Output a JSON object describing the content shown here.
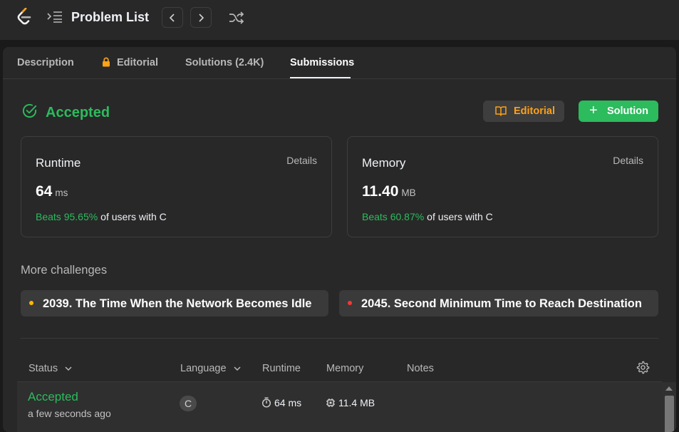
{
  "topbar": {
    "logo": "leetcode-logo",
    "problem_list_icon": "list-indent-icon",
    "title": "Problem List",
    "prev_icon": "chevron-left-icon",
    "next_icon": "chevron-right-icon",
    "shuffle_icon": "shuffle-icon"
  },
  "tabs": [
    {
      "label": "Description",
      "active": false
    },
    {
      "label": "Editorial",
      "active": false,
      "icon": "lock-icon"
    },
    {
      "label": "Solutions (2.4K)",
      "active": false
    },
    {
      "label": "Submissions",
      "active": true
    }
  ],
  "result": {
    "status": "Accepted",
    "editorial_button": "Editorial",
    "solution_button": "Solution"
  },
  "runtime_card": {
    "title": "Runtime",
    "details": "Details",
    "value": "64",
    "unit": "ms",
    "beats": "Beats 95.65%",
    "beats_suffix": "of users with C"
  },
  "memory_card": {
    "title": "Memory",
    "details": "Details",
    "value": "11.40",
    "unit": "MB",
    "beats": "Beats 60.87%",
    "beats_suffix": "of users with C"
  },
  "challenges": {
    "title": "More challenges",
    "items": [
      {
        "label": "2039. The Time When the Network Becomes Idle",
        "difficulty_color": "#ffb800"
      },
      {
        "label": "2045. Second Minimum Time to Reach Destination",
        "difficulty_color": "#f63737"
      }
    ]
  },
  "table": {
    "headers": {
      "status": "Status",
      "language": "Language",
      "runtime": "Runtime",
      "memory": "Memory",
      "notes": "Notes"
    },
    "rows": [
      {
        "status": "Accepted",
        "time": "a few seconds ago",
        "language": "C",
        "runtime": "64 ms",
        "memory": "11.4 MB",
        "notes": ""
      }
    ]
  },
  "colors": {
    "accent_green": "#2cbb5d",
    "accent_orange": "#ffa116",
    "background": "#1a1a1a",
    "panel": "#282828"
  }
}
